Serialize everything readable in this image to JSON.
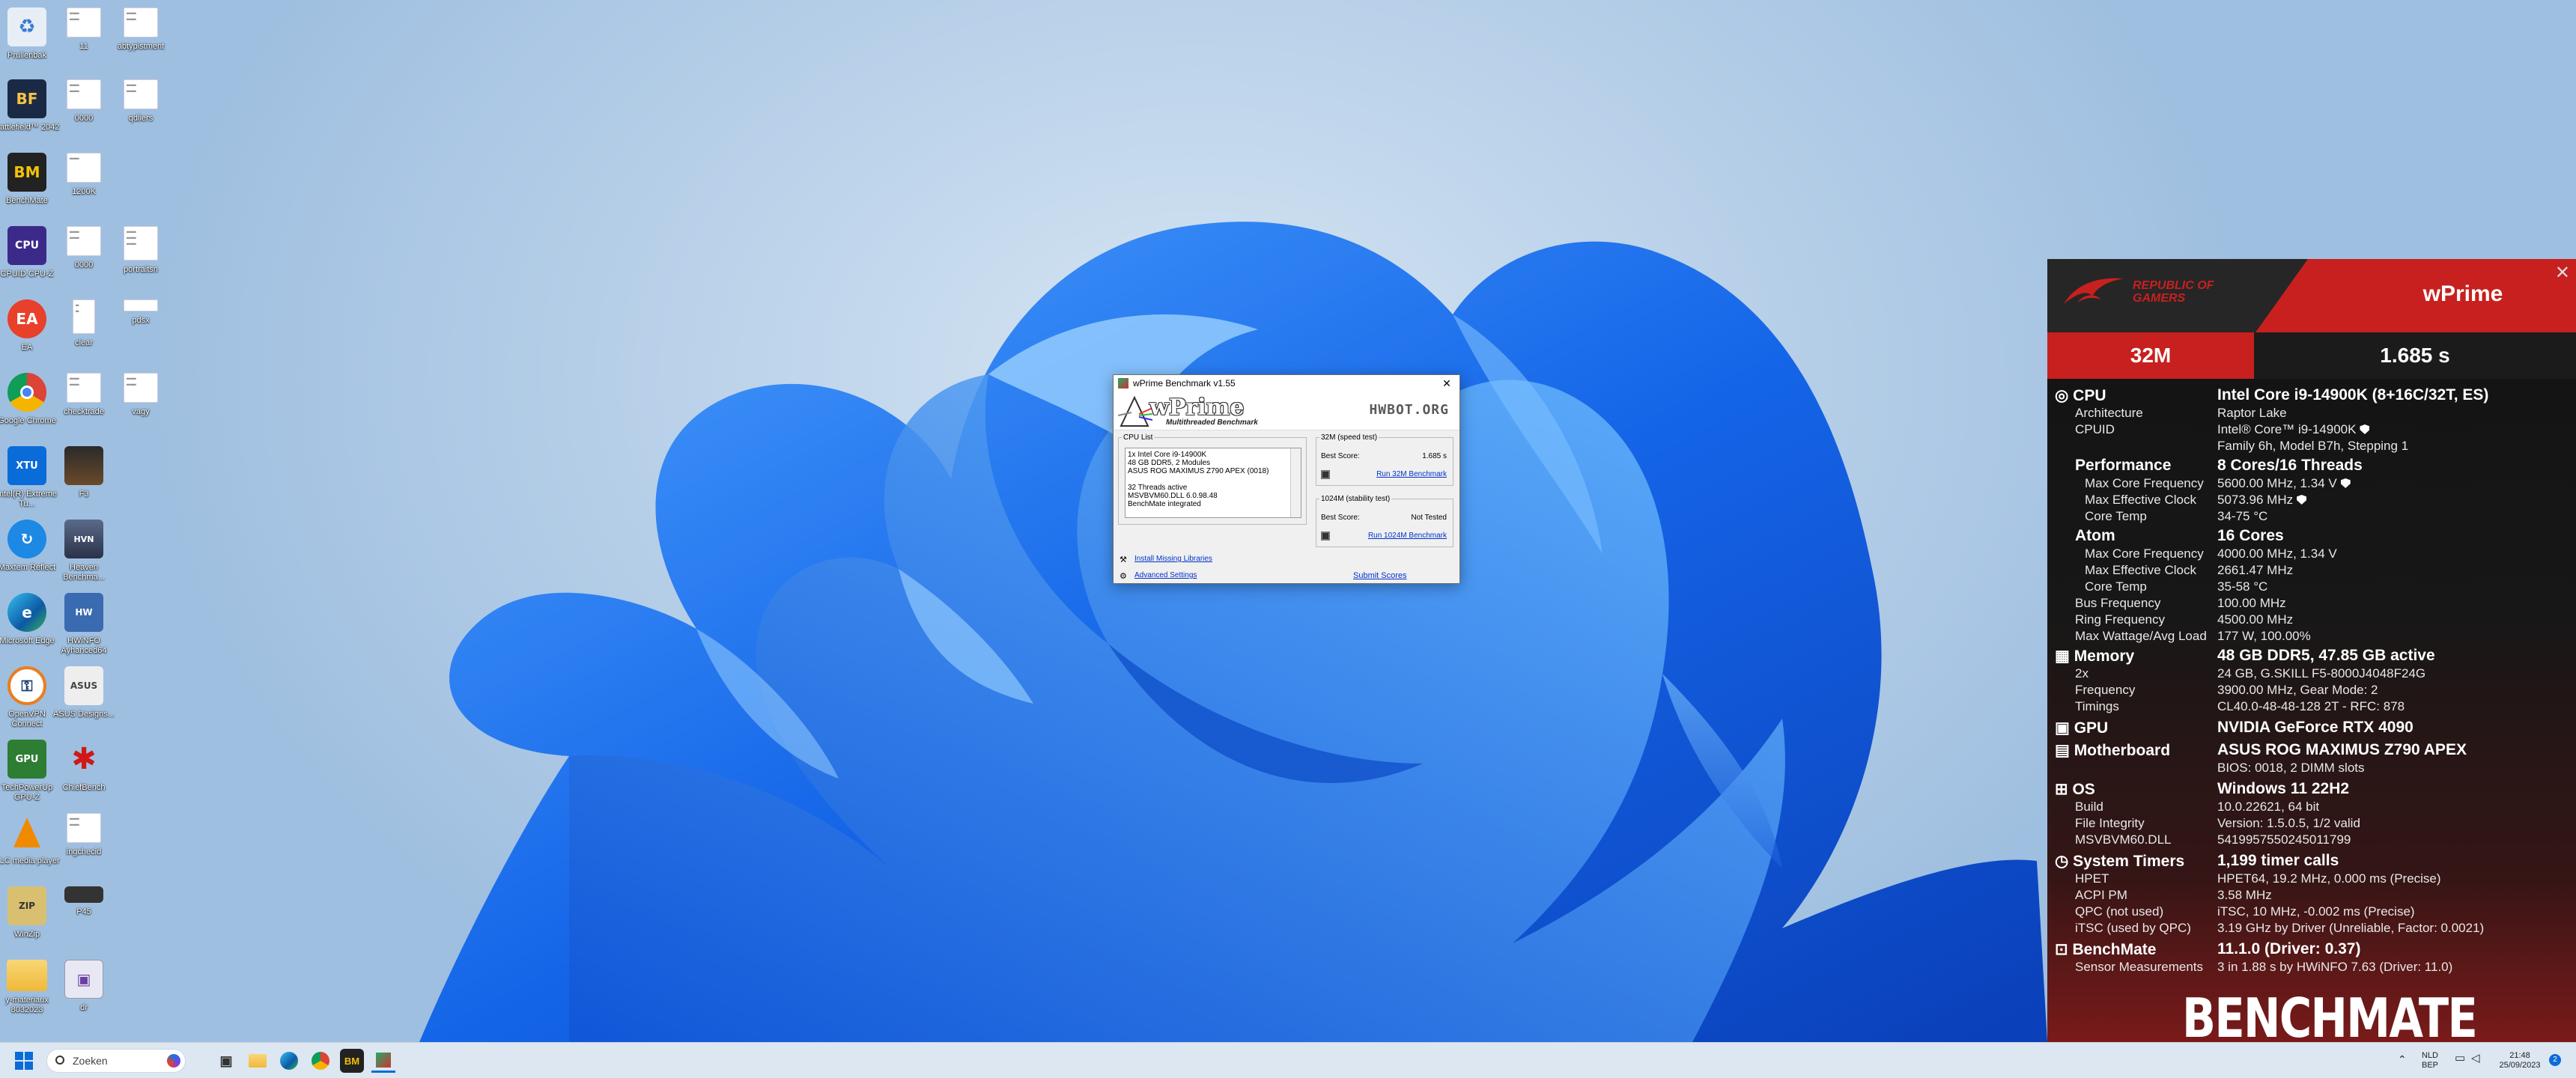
{
  "desktop": {
    "icons": [
      {
        "label": "Prullenbak",
        "icon": "recycle-bin-icon"
      },
      {
        "label": "11",
        "icon": "document-icon"
      },
      {
        "label": "abtypistment",
        "icon": "document-icon"
      },
      {
        "label": "Battlefield™ 2042",
        "icon": "bf-game-icon"
      },
      {
        "label": "0000",
        "icon": "document-icon"
      },
      {
        "label": "qdliers",
        "icon": "document-icon"
      },
      {
        "label": "BenchMate",
        "icon": "benchmate-icon"
      },
      {
        "label": "1200K",
        "icon": "document-icon"
      },
      {
        "label": "CPUID CPU-Z",
        "icon": "cpuz-icon"
      },
      {
        "label": "0000",
        "icon": "document-icon"
      },
      {
        "label": "portraitsn",
        "icon": "document-icon"
      },
      {
        "label": "EA",
        "icon": "ea-icon"
      },
      {
        "label": "clear",
        "icon": "document-icon"
      },
      {
        "label": "pdsx",
        "icon": "document-icon"
      },
      {
        "label": "Google Chrome",
        "icon": "chrome-icon"
      },
      {
        "label": "checktrade",
        "icon": "document-icon"
      },
      {
        "label": "vagy",
        "icon": "document-icon"
      },
      {
        "label": "Intel(R) Extreme Tu...",
        "icon": "intel-xtu-icon"
      },
      {
        "label": "F3",
        "icon": "image-icon"
      },
      {
        "label": "Maxtem Reflect",
        "icon": "macrium-icon"
      },
      {
        "label": "Heaven Benchma...",
        "icon": "heaven-icon"
      },
      {
        "label": "Microsoft Edge",
        "icon": "edge-icon"
      },
      {
        "label": "HWiNFO Ayhanced64",
        "icon": "hwinfo-icon"
      },
      {
        "label": "OpenVPN Connect",
        "icon": "openvpn-icon"
      },
      {
        "label": "ASUS Designs...",
        "icon": "asus-icon"
      },
      {
        "label": "TechPowerUp GPU-Z",
        "icon": "gpuz-icon"
      },
      {
        "label": "ChiefBench",
        "icon": "spider-icon"
      },
      {
        "label": "VLC media player",
        "icon": "vlc-icon"
      },
      {
        "label": "ingchecid",
        "icon": "document-icon"
      },
      {
        "label": "WinZip",
        "icon": "winzip-icon"
      },
      {
        "label": "P45",
        "icon": "image-icon"
      },
      {
        "label": "y-materiaux 8032023",
        "icon": "folder-icon"
      },
      {
        "label": "dr",
        "icon": "app-icon"
      }
    ]
  },
  "wprime": {
    "title": "wPrime Benchmark v1.55",
    "logo": "wPrime",
    "subtitle": "Multithreaded Benchmark",
    "hwbot": "HWBOT.ORG",
    "cpu_list_legend": "CPU List",
    "cpu_lines": [
      "1x Intel Core i9-14900K",
      "48 GB DDR5, 2 Modules",
      "ASUS ROG MAXIMUS Z790 APEX (0018)",
      "",
      "32 Threads active",
      "MSVBVM60.DLL 6.0.98.48",
      "BenchMate integrated"
    ],
    "test32_legend": "32M (speed test)",
    "test32_best_label": "Best Score:",
    "test32_best_value": "1.685 s",
    "test32_run": "Run 32M Benchmark",
    "test1024_legend": "1024M (stability test)",
    "test1024_best_label": "Best Score:",
    "test1024_best_value": "Not Tested",
    "test1024_run": "Run 1024M Benchmark",
    "install_libs": "Install Missing Libraries",
    "advanced": "Advanced Settings",
    "submit": "Submit Scores"
  },
  "benchmate": {
    "rog_line1": "REPUBLIC OF",
    "rog_line2": "GAMERS",
    "benchmark": "wPrime",
    "size": "32M",
    "score": "1.685 s",
    "cpu": {
      "label": "CPU",
      "value": "Intel Core i9-14900K (8+16C/32T, ES)",
      "arch_k": "Architecture",
      "arch_v": "Raptor Lake",
      "cpuid_k": "CPUID",
      "cpuid_v": "Intel® Core™ i9-14900K",
      "cpuid_v2": "Family 6h, Model B7h, Stepping 1",
      "perf_k": "Performance",
      "perf_v": "8 Cores/16 Threads",
      "pmcf_k": "Max Core Frequency",
      "pmcf_v": "5600.00 MHz, 1.34 V",
      "pmec_k": "Max Effective Clock",
      "pmec_v": "5073.96 MHz",
      "pct_k": "Core Temp",
      "pct_v": "34-75 °C",
      "atom_k": "Atom",
      "atom_v": "16 Cores",
      "amcf_k": "Max Core Frequency",
      "amcf_v": "4000.00 MHz, 1.34 V",
      "amec_k": "Max Effective Clock",
      "amec_v": "2661.47 MHz",
      "act_k": "Core Temp",
      "act_v": "35-58 °C",
      "bus_k": "Bus Frequency",
      "bus_v": "100.00 MHz",
      "ring_k": "Ring Frequency",
      "ring_v": "4500.00 MHz",
      "watt_k": "Max Wattage/Avg Load",
      "watt_v": "177 W, 100.00%"
    },
    "memory": {
      "label": "Memory",
      "value": "48 GB DDR5, 47.85 GB active",
      "mod_k": "2x",
      "mod_v": "24 GB, G.SKILL F5-8000J4048F24G",
      "freq_k": "Frequency",
      "freq_v": "3900.00 MHz, Gear Mode: 2",
      "tim_k": "Timings",
      "tim_v": "CL40.0-48-48-128 2T - RFC: 878"
    },
    "gpu": {
      "label": "GPU",
      "value": "NVIDIA GeForce RTX 4090"
    },
    "mobo": {
      "label": "Motherboard",
      "value": "ASUS ROG MAXIMUS Z790 APEX",
      "bios": "BIOS: 0018, 2 DIMM slots"
    },
    "os": {
      "label": "OS",
      "value": "Windows 11 22H2",
      "build_k": "Build",
      "build_v": "10.0.22621, 64 bit",
      "fi_k": "File Integrity",
      "fi_v": "Version: 1.5.0.5, 1/2 valid",
      "dll_k": "MSVBVM60.DLL",
      "dll_v": "5419957550245011799"
    },
    "timers": {
      "label": "System Timers",
      "value": "1,199 timer calls",
      "hpet_k": "HPET",
      "hpet_v": "HPET64, 19.2 MHz, 0.000 ms (Precise)",
      "acpi_k": "ACPI PM",
      "acpi_v": "3.58 MHz",
      "qpc_k": "QPC (not used)",
      "qpc_v": "iTSC, 10 MHz, -0.002 ms (Precise)",
      "itsc_k": "iTSC (used by QPC)",
      "itsc_v": "3.19 GHz by Driver (Unreliable, Factor: 0.0021)"
    },
    "bench": {
      "label": "BenchMate",
      "value": "11.1.0 (Driver: 0.37)",
      "sens_k": "Sensor Measurements",
      "sens_v": "3 in 1.88 s by HWiNFO 7.63 (Driver: 11.0)"
    },
    "logo": "BENCHMATE"
  },
  "taskbar": {
    "search_placeholder": "Zoeken",
    "lang_line1": "NLD",
    "lang_line2": "BEP",
    "time": "21:48",
    "date": "25/09/2023"
  },
  "colors": {
    "rog_red": "#c8201e",
    "accent": "#0a6cd8"
  }
}
